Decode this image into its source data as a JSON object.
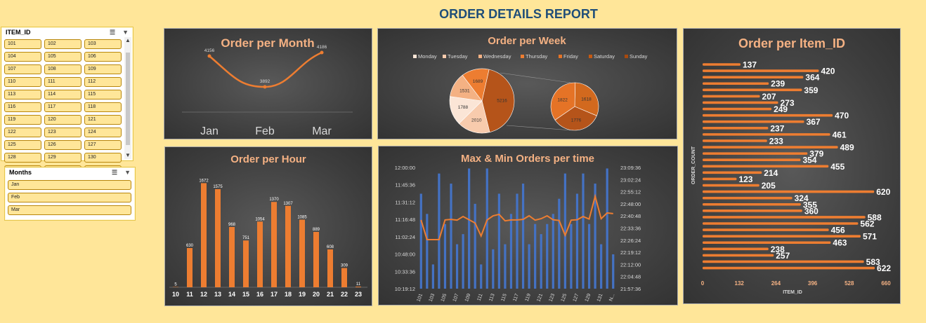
{
  "report_title": "ORDER DETAILS REPORT",
  "colors": {
    "accent": "#ED7D31",
    "title": "#1F4E79",
    "slicer_fill": "#FFE699",
    "bar_blue": "#4472C4"
  },
  "slicer_items": {
    "title": "ITEM_ID",
    "items": [
      "101",
      "102",
      "103",
      "104",
      "105",
      "106",
      "107",
      "108",
      "109",
      "110",
      "111",
      "112",
      "113",
      "114",
      "115",
      "116",
      "117",
      "118",
      "119",
      "120",
      "121",
      "122",
      "123",
      "124",
      "125",
      "126",
      "127",
      "128",
      "129",
      "130",
      "131",
      "132",
      "NULL"
    ]
  },
  "slicer_months": {
    "title": "Months",
    "items": [
      "Jan",
      "Feb",
      "Mar"
    ]
  },
  "chart_data": [
    {
      "type": "line",
      "title": "Order per Month",
      "categories": [
        "Jan",
        "Feb",
        "Mar"
      ],
      "values": [
        4156,
        3892,
        4186
      ],
      "ylim": [
        3700,
        4300
      ]
    },
    {
      "type": "pie",
      "title": "Order per Week",
      "legend": [
        "Monday",
        "Tuesday",
        "Wednesday",
        "Thursday",
        "Friday",
        "Saturday",
        "Sunday"
      ],
      "legend_position": "top",
      "main_values": [
        5216,
        2010,
        1788,
        1531,
        1689
      ],
      "secondary_values": [
        1618,
        1776,
        1822
      ]
    },
    {
      "type": "bar",
      "title": "Order per Hour",
      "categories": [
        "10",
        "11",
        "12",
        "13",
        "14",
        "15",
        "16",
        "17",
        "18",
        "19",
        "20",
        "21",
        "22",
        "23"
      ],
      "values": [
        5,
        630,
        1672,
        1575,
        968,
        751,
        1054,
        1370,
        1307,
        1085,
        889,
        608,
        309,
        11
      ],
      "ylim": [
        0,
        1800
      ]
    },
    {
      "type": "bar",
      "title": "Max & Min Orders per time",
      "categories": [
        "101",
        "102",
        "103",
        "104",
        "105",
        "106",
        "107",
        "108",
        "109",
        "110",
        "111",
        "112",
        "113",
        "114",
        "115",
        "116",
        "117",
        "118",
        "119",
        "120",
        "121",
        "122",
        "123",
        "124",
        "125",
        "126",
        "127",
        "128",
        "129",
        "130",
        "131",
        "132",
        "N..."
      ],
      "x_tick_labels": [
        "101",
        "103",
        "105",
        "107",
        "109",
        "111",
        "113",
        "115",
        "117",
        "119",
        "121",
        "123",
        "125",
        "127",
        "129",
        "131",
        "N..."
      ],
      "y_left_ticks": [
        "12:00:00",
        "11:45:36",
        "11:31:12",
        "11:16:48",
        "11:02:24",
        "10:48:00",
        "10:33:36",
        "10:19:12"
      ],
      "y_right_ticks": [
        "23:09:36",
        "23:02:24",
        "22:55:12",
        "22:48:00",
        "22:40:48",
        "22:33:36",
        "22:26:24",
        "22:19:12",
        "22:12:00",
        "22:04:48",
        "21:57:36"
      ],
      "series": [
        {
          "values": [
            22.9,
            22.7,
            22.2,
            23.1,
            22.6,
            23.0,
            22.4,
            22.5,
            23.15,
            22.8,
            22.2,
            23.15,
            22.35,
            22.9,
            22.4,
            22.7,
            22.9,
            23.0,
            22.4,
            22.6,
            22.5,
            22.6,
            22.7,
            22.85,
            23.1,
            22.6,
            22.9,
            23.1,
            22.6,
            23.0,
            22.4,
            23.15,
            22.3
          ]
        },
        {
          "values": [
            11.2725,
            11.0,
            11.0,
            11.0,
            11.2725,
            11.28,
            11.27,
            11.32,
            11.275,
            11.23,
            11.05,
            11.2725,
            11.33,
            11.35,
            11.26,
            11.2725,
            11.2725,
            11.28,
            11.33,
            11.27,
            11.29,
            11.33,
            11.275,
            11.265,
            11.06,
            11.27,
            11.275,
            11.32,
            11.285,
            11.6,
            11.29,
            11.37,
            11.36
          ]
        }
      ]
    },
    {
      "type": "bar",
      "title": "Order per Item_ID",
      "xlabel": "ITEM_ID",
      "ylabel": "ORDER_COUNT",
      "xlim": [
        0,
        660
      ],
      "x_ticks": [
        "0",
        "132",
        "264",
        "396",
        "528",
        "660"
      ],
      "values": [
        137,
        420,
        364,
        239,
        359,
        207,
        273,
        249,
        470,
        367,
        237,
        461,
        233,
        489,
        379,
        354,
        455,
        214,
        123,
        205,
        620,
        324,
        355,
        360,
        588,
        562,
        456,
        571,
        463,
        238,
        257,
        583,
        622
      ]
    }
  ]
}
